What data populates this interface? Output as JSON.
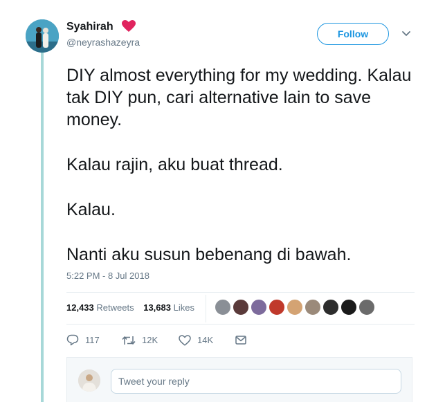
{
  "tweet": {
    "author_name": "Syahirah",
    "handle": "@neyrashazeyra",
    "follow_label": "Follow",
    "text_paragraphs": [
      "DIY almost everything for my wedding. Kalau tak DIY pun, cari alternative lain to save money.",
      "Kalau rajin, aku buat thread.",
      "Kalau.",
      "Nanti aku susun bebenang di bawah."
    ],
    "timestamp": "5:22 PM - 8 Jul 2018",
    "stats": {
      "retweets_count": "12,433",
      "retweets_label": "Retweets",
      "likes_count": "13,683",
      "likes_label": "Likes"
    },
    "likers": [
      {
        "icon": "liker-avatar",
        "color": "#8a8f96"
      },
      {
        "icon": "liker-avatar",
        "color": "#5a3a3a"
      },
      {
        "icon": "liker-avatar",
        "color": "#7d6b9c"
      },
      {
        "icon": "liker-avatar",
        "color": "#c0392b"
      },
      {
        "icon": "liker-avatar",
        "color": "#d4a373"
      },
      {
        "icon": "liker-avatar",
        "color": "#9b8a7a"
      },
      {
        "icon": "liker-avatar",
        "color": "#2d2d2d"
      },
      {
        "icon": "liker-avatar",
        "color": "#1a1a1a"
      },
      {
        "icon": "liker-avatar",
        "color": "#6b6b6b"
      }
    ],
    "actions": {
      "reply_count": "117",
      "retweet_count": "12K",
      "like_count": "14K"
    },
    "reply_placeholder": "Tweet your reply",
    "colors": {
      "accent": "#1b95e0",
      "heart": "#e0245e",
      "thread_line": "#a7d8d8",
      "muted": "#657786"
    }
  }
}
